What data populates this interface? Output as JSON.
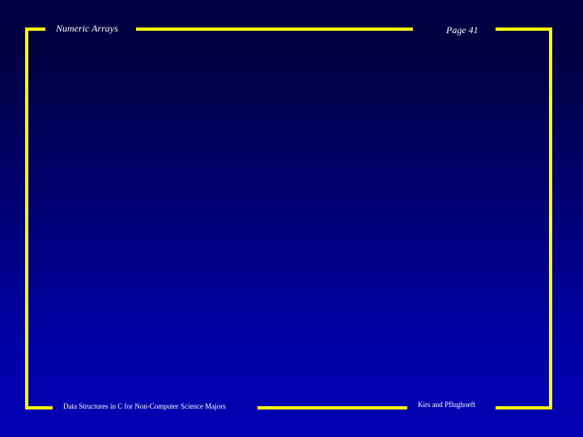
{
  "slide": {
    "header_title": "Numeric Arrays",
    "page_label": "Page 41",
    "footer_course": "Data Structures in C for Non-Computer Science Majors",
    "footer_authors": "Kirs and Pflughoeft"
  },
  "colors": {
    "frame": "#ffff00",
    "background_top": "#000044",
    "background_bottom": "#0000b2",
    "text": "#ffffff"
  }
}
